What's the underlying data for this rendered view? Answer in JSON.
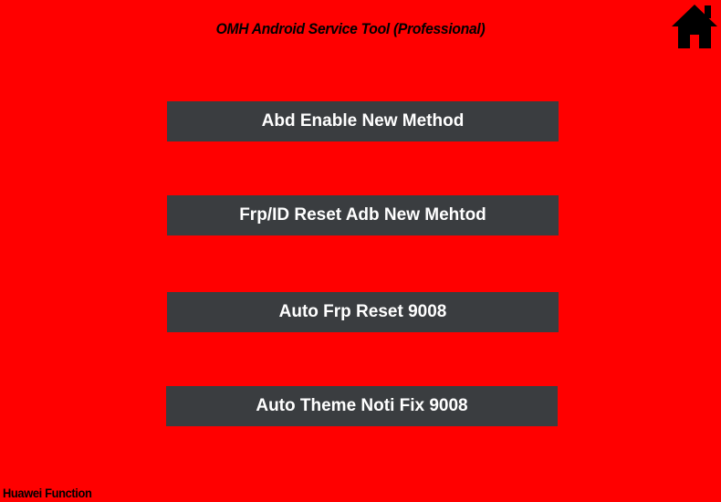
{
  "window": {
    "title": "OMH Android Service Tool  (Professional)",
    "background_color": "#ff0000"
  },
  "home": {
    "icon": "home-icon"
  },
  "actions": [
    {
      "label": "Abd Enable New Method"
    },
    {
      "label": "Frp/ID Reset Adb New Mehtod"
    },
    {
      "label": "Auto Frp Reset 9008"
    },
    {
      "label": "Auto Theme Noti Fix 9008"
    }
  ],
  "button_color": "#3a3d40",
  "footer": {
    "label": "Huawei Function"
  }
}
